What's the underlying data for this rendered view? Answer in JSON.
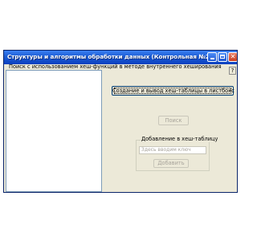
{
  "window": {
    "title": "Структуры и алгоритмы обработки данных (Контрольная №2)",
    "controls": {
      "minimize": "",
      "maximize": "",
      "close": "✕",
      "help": "?"
    }
  },
  "group": {
    "label": "Поиск с использованием хеш-функций в методе внутреннего хеширования"
  },
  "listbox": {
    "items": []
  },
  "buttons": {
    "create": "Создание и вывод хеш-таблицы в листбокс",
    "search": "Поиск",
    "add": "Добавить"
  },
  "add_section": {
    "legend": "Добавление в хеш-таблицу",
    "key_placeholder": "Здесь вводим ключ"
  },
  "colors": {
    "titlebar": "#0a3fbf",
    "window_bg": "#ece9d8",
    "disabled_text": "#a7a39a"
  }
}
